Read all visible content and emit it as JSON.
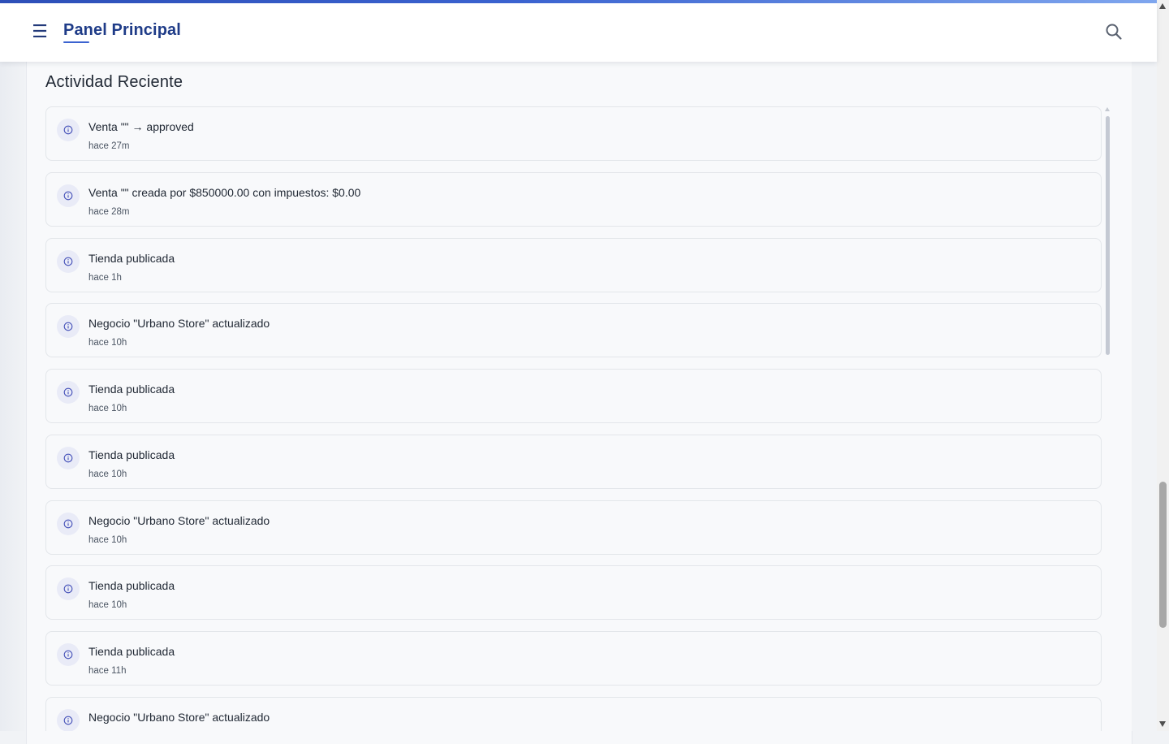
{
  "header": {
    "title": "Panel Principal",
    "menu_icon": "hamburger-menu-icon",
    "search_icon": "search-icon",
    "accent_color": "#1f3c88"
  },
  "section": {
    "title": "Actividad Reciente"
  },
  "activities": [
    {
      "text": "Venta \"\" → approved",
      "time": "hace 27m",
      "icon": "info-icon"
    },
    {
      "text": "Venta \"\" creada por $850000.00 con impuestos: $0.00",
      "time": "hace 28m",
      "icon": "info-icon"
    },
    {
      "text": "Tienda publicada",
      "time": "hace 1h",
      "icon": "info-icon"
    },
    {
      "text": "Negocio \"Urbano Store\" actualizado",
      "time": "hace 10h",
      "icon": "info-icon"
    },
    {
      "text": "Tienda publicada",
      "time": "hace 10h",
      "icon": "info-icon"
    },
    {
      "text": "Tienda publicada",
      "time": "hace 10h",
      "icon": "info-icon"
    },
    {
      "text": "Negocio \"Urbano Store\" actualizado",
      "time": "hace 10h",
      "icon": "info-icon"
    },
    {
      "text": "Tienda publicada",
      "time": "hace 10h",
      "icon": "info-icon"
    },
    {
      "text": "Tienda publicada",
      "time": "hace 11h",
      "icon": "info-icon"
    },
    {
      "text": "Negocio \"Urbano Store\" actualizado",
      "time": "",
      "icon": "info-icon"
    }
  ]
}
